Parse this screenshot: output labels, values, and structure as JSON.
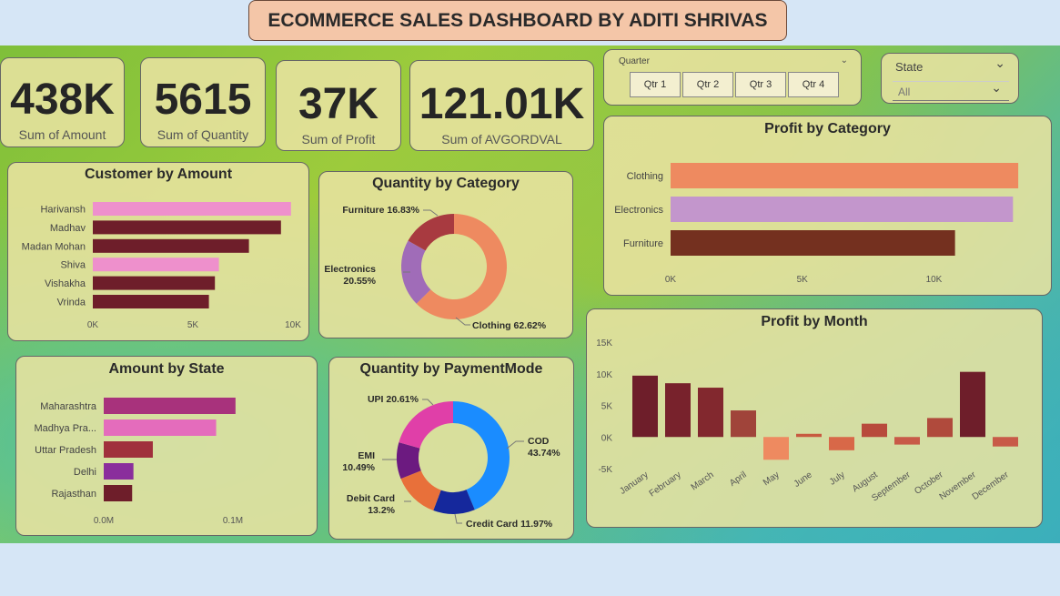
{
  "title": "ECOMMERCE SALES DASHBOARD BY ADITI SHRIVAS",
  "kpis": [
    {
      "value": "438K",
      "label": "Sum of Amount"
    },
    {
      "value": "5615",
      "label": "Sum of Quantity"
    },
    {
      "value": "37K",
      "label": "Sum of Profit"
    },
    {
      "value": "121.01K",
      "label": "Sum of AVGORDVAL"
    }
  ],
  "quarter_slicer": {
    "label": "Quarter",
    "buttons": [
      "Qtr 1",
      "Qtr 2",
      "Qtr 3",
      "Qtr 4"
    ]
  },
  "state_slicer": {
    "label": "State",
    "selected": "All"
  },
  "colors": {
    "pink": "#ee90cc",
    "maroon": "#6e1e2a",
    "orange": "#ee8a60",
    "purple": "#b07ac8",
    "lavender": "#c396cc",
    "brown": "#74301f",
    "magenta": "#a8327c",
    "pink2": "#e46cbc",
    "red": "#a0303c",
    "violet": "#8a2e9c"
  },
  "chart_data": [
    {
      "id": "customer_by_amount",
      "type": "bar",
      "orientation": "horizontal",
      "title": "Customer by Amount",
      "categories": [
        "Harivansh",
        "Madhav",
        "Madan Mohan",
        "Shiva",
        "Vishakha",
        "Vrinda"
      ],
      "values": [
        9900,
        9400,
        7800,
        6300,
        6100,
        5800
      ],
      "bar_colors": [
        "#ee90cc",
        "#6e1e2a",
        "#6e1e2a",
        "#ee90cc",
        "#6e1e2a",
        "#6e1e2a"
      ],
      "xticks": [
        "0K",
        "5K",
        "10K"
      ],
      "xlim": [
        0,
        10000
      ]
    },
    {
      "id": "quantity_by_category",
      "type": "pie",
      "donut": true,
      "title": "Quantity by Category",
      "slices": [
        {
          "name": "Clothing",
          "label": "Clothing 62.62%",
          "value": 62.62,
          "color": "#ee8a60"
        },
        {
          "name": "Electronics",
          "label": "Electronics 20.55%",
          "value": 20.55,
          "color": "#a06cb8"
        },
        {
          "name": "Furniture",
          "label": "Furniture 16.83%",
          "value": 16.83,
          "color": "#a83a40"
        }
      ]
    },
    {
      "id": "profit_by_category",
      "type": "bar",
      "orientation": "horizontal",
      "title": "Profit by Category",
      "categories": [
        "Clothing",
        "Electronics",
        "Furniture"
      ],
      "values": [
        13200,
        13000,
        10800
      ],
      "bar_colors": [
        "#ee8a60",
        "#c396cc",
        "#74301f"
      ],
      "xticks": [
        "0K",
        "5K",
        "10K"
      ],
      "xlim": [
        0,
        13300
      ]
    },
    {
      "id": "amount_by_state",
      "type": "bar",
      "orientation": "horizontal",
      "title": "Amount by State",
      "categories": [
        "Maharashtra",
        "Madhya Pra...",
        "Uttar Pradesh",
        "Delhi",
        "Rajasthan"
      ],
      "values": [
        0.102,
        0.087,
        0.038,
        0.023,
        0.022
      ],
      "bar_colors": [
        "#a8327c",
        "#e46cbc",
        "#a0303c",
        "#8a2e9c",
        "#6e1e2a"
      ],
      "xticks": [
        "0.0M",
        "0.1M"
      ],
      "xlim": [
        0,
        0.1
      ]
    },
    {
      "id": "quantity_by_paymentmode",
      "type": "pie",
      "donut": true,
      "title": "Quantity by PaymentMode",
      "slices": [
        {
          "name": "COD",
          "label": "COD 43.74%",
          "value": 43.74,
          "color": "#1a8cff"
        },
        {
          "name": "Credit Card",
          "label": "Credit Card 11.97%",
          "value": 11.97,
          "color": "#15289c"
        },
        {
          "name": "Debit Card",
          "label": "Debit Card 13.2%",
          "value": 13.2,
          "color": "#e8703a"
        },
        {
          "name": "EMI",
          "label": "EMI 10.49%",
          "value": 10.49,
          "color": "#6c1a80"
        },
        {
          "name": "UPI",
          "label": "UPI 20.61%",
          "value": 20.61,
          "color": "#e03fa8"
        }
      ]
    },
    {
      "id": "profit_by_month",
      "type": "bar",
      "orientation": "vertical",
      "title": "Profit by Month",
      "categories": [
        "January",
        "February",
        "March",
        "April",
        "May",
        "June",
        "July",
        "August",
        "September",
        "October",
        "November",
        "December"
      ],
      "values": [
        9700,
        8500,
        7800,
        4200,
        -3600,
        500,
        -2100,
        2100,
        -1200,
        3000,
        10300,
        -1500
      ],
      "bar_colors": [
        "#6e1e2a",
        "#78222c",
        "#82282e",
        "#a0443a",
        "#ee8a60",
        "#c85a40",
        "#d86848",
        "#b84a3c",
        "#c85a48",
        "#b04a3c",
        "#6e1e2a",
        "#c85a48"
      ],
      "yticks": [
        "-5K",
        "0K",
        "5K",
        "10K",
        "15K"
      ],
      "ylim": [
        -5000,
        15000
      ]
    }
  ]
}
